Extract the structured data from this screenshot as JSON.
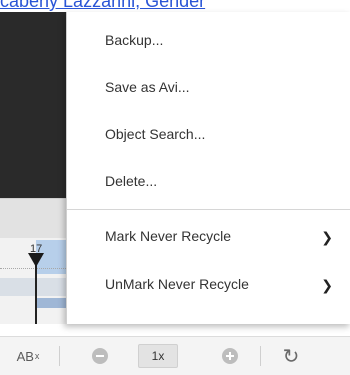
{
  "top_link": {
    "text": "cabeny Lazzarini, Gender"
  },
  "timeline": {
    "marker_label": "17"
  },
  "menu": {
    "items": [
      {
        "label": "Backup..."
      },
      {
        "label": "Save as Avi..."
      },
      {
        "label": "Object Search..."
      },
      {
        "label": "Delete..."
      }
    ],
    "submenu_items": [
      {
        "label": "Mark Never Recycle",
        "icon": "chevron-right-icon"
      },
      {
        "label": "UnMark Never Recycle",
        "icon": "chevron-right-icon"
      }
    ]
  },
  "toolbar": {
    "ab_label": "AB",
    "ab_sup": "x",
    "zoom_out_icon": "minus-circle-icon",
    "speed_label": "1x",
    "zoom_in_icon": "plus-circle-icon",
    "refresh_icon": "refresh-icon"
  }
}
